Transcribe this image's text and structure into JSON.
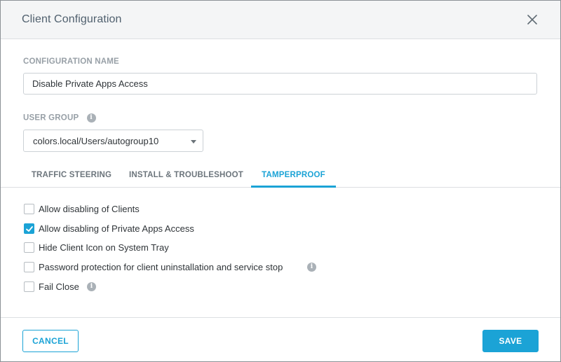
{
  "dialog": {
    "title": "Client Configuration",
    "close_icon": "close-icon"
  },
  "form": {
    "config_name_label": "CONFIGURATION NAME",
    "config_name_value": "Disable Private Apps Access",
    "user_group_label": "USER GROUP",
    "user_group_info_icon": "info-icon",
    "user_group_value": "colors.local/Users/autogroup10"
  },
  "tabs": [
    {
      "label": "TRAFFIC STEERING",
      "active": false
    },
    {
      "label": "INSTALL & TROUBLESHOOT",
      "active": false
    },
    {
      "label": "TAMPERPROOF",
      "active": true
    }
  ],
  "options": [
    {
      "label": "Allow disabling of Clients",
      "checked": false,
      "has_info": false
    },
    {
      "label": "Allow disabling of Private Apps Access",
      "checked": true,
      "has_info": false
    },
    {
      "label": "Hide Client Icon on System Tray",
      "checked": false,
      "has_info": false
    },
    {
      "label": "Password protection for client uninstallation and service stop",
      "checked": false,
      "has_info": true
    },
    {
      "label": "Fail Close",
      "checked": false,
      "has_info": true
    }
  ],
  "footer": {
    "cancel_label": "CANCEL",
    "save_label": "SAVE"
  },
  "colors": {
    "accent": "#1ba3d6",
    "header_bg": "#f4f5f6",
    "label_gray": "#98a0a7"
  }
}
